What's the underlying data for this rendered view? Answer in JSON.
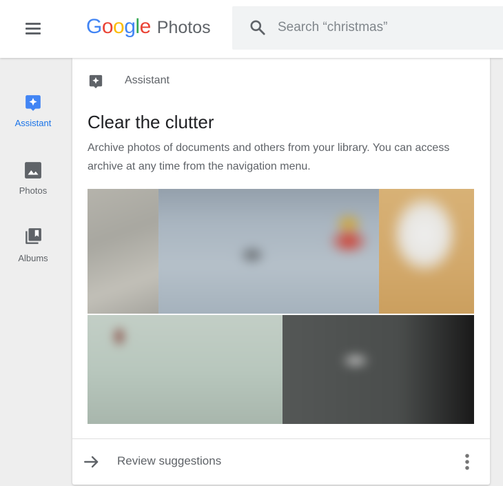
{
  "header": {
    "logo_google": [
      "G",
      "o",
      "o",
      "g",
      "l",
      "e"
    ],
    "logo_product": "Photos",
    "menu_icon": "hamburger-menu-icon",
    "search": {
      "icon": "search-icon",
      "placeholder": "Search “christmas”",
      "value": ""
    }
  },
  "sidebar": {
    "items": [
      {
        "label": "Assistant",
        "icon": "assistant-icon",
        "active": true
      },
      {
        "label": "Photos",
        "icon": "photo-icon",
        "active": false
      },
      {
        "label": "Albums",
        "icon": "albums-icon",
        "active": false
      }
    ]
  },
  "card": {
    "header_label": "Assistant",
    "header_icon": "assistant-icon",
    "title": "Clear the clutter",
    "description": "Archive photos of documents and others from your library. You can access archive at any time from the navigation menu.",
    "footer": {
      "icon": "arrow-right-icon",
      "label": "Review suggestions",
      "more_icon": "more-vert-icon"
    }
  },
  "colors": {
    "accent": "#1a73e8",
    "text_primary": "#202124",
    "text_secondary": "#5f6368",
    "background": "#eeeeee"
  }
}
